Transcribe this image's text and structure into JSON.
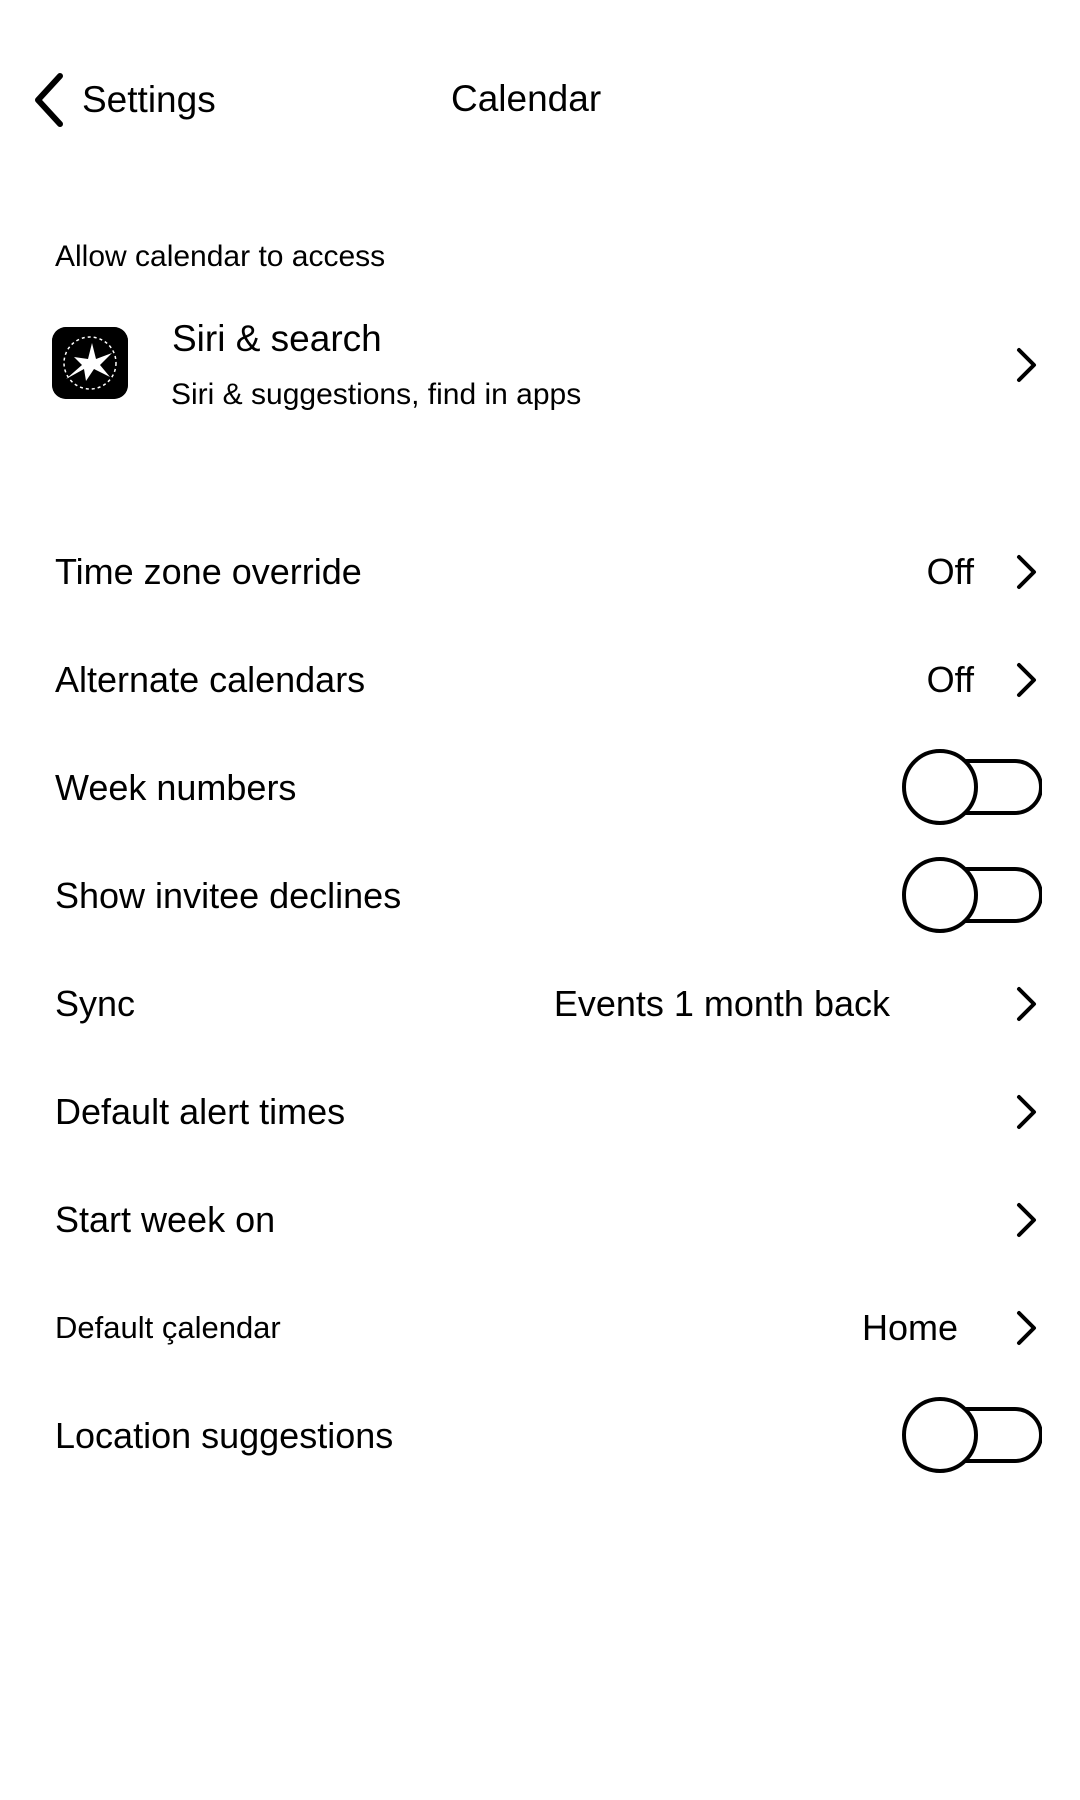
{
  "nav": {
    "back_label": "Settings",
    "title": "Calendar"
  },
  "access_section": {
    "header": "Allow calendar to access",
    "siri": {
      "title": "Siri & search",
      "subtitle": "Siri & suggestions, find in apps",
      "icon": "siri-app-icon"
    }
  },
  "settings": {
    "time_zone_override": {
      "label": "Time zone override",
      "value": "Off"
    },
    "alternate_calendars": {
      "label": "Alternate calendars",
      "value": "Off"
    },
    "week_numbers": {
      "label": "Week numbers",
      "toggle_on": false
    },
    "show_invitee_declines": {
      "label": "Show invitee declines",
      "toggle_on": false
    },
    "sync": {
      "label": "Sync",
      "value": "Events 1 month back"
    },
    "default_alert_times": {
      "label": "Default alert times"
    },
    "start_week_on": {
      "label": "Start week on"
    },
    "default_calendar": {
      "label": "Default çalendar",
      "value": "Home"
    },
    "location_suggestions": {
      "label": "Location suggestions",
      "toggle_on": false
    }
  },
  "icons": {
    "back": "chevron-left-icon",
    "disclosure": "chevron-right-icon"
  },
  "colors": {
    "foreground": "#000000",
    "background": "#ffffff"
  }
}
